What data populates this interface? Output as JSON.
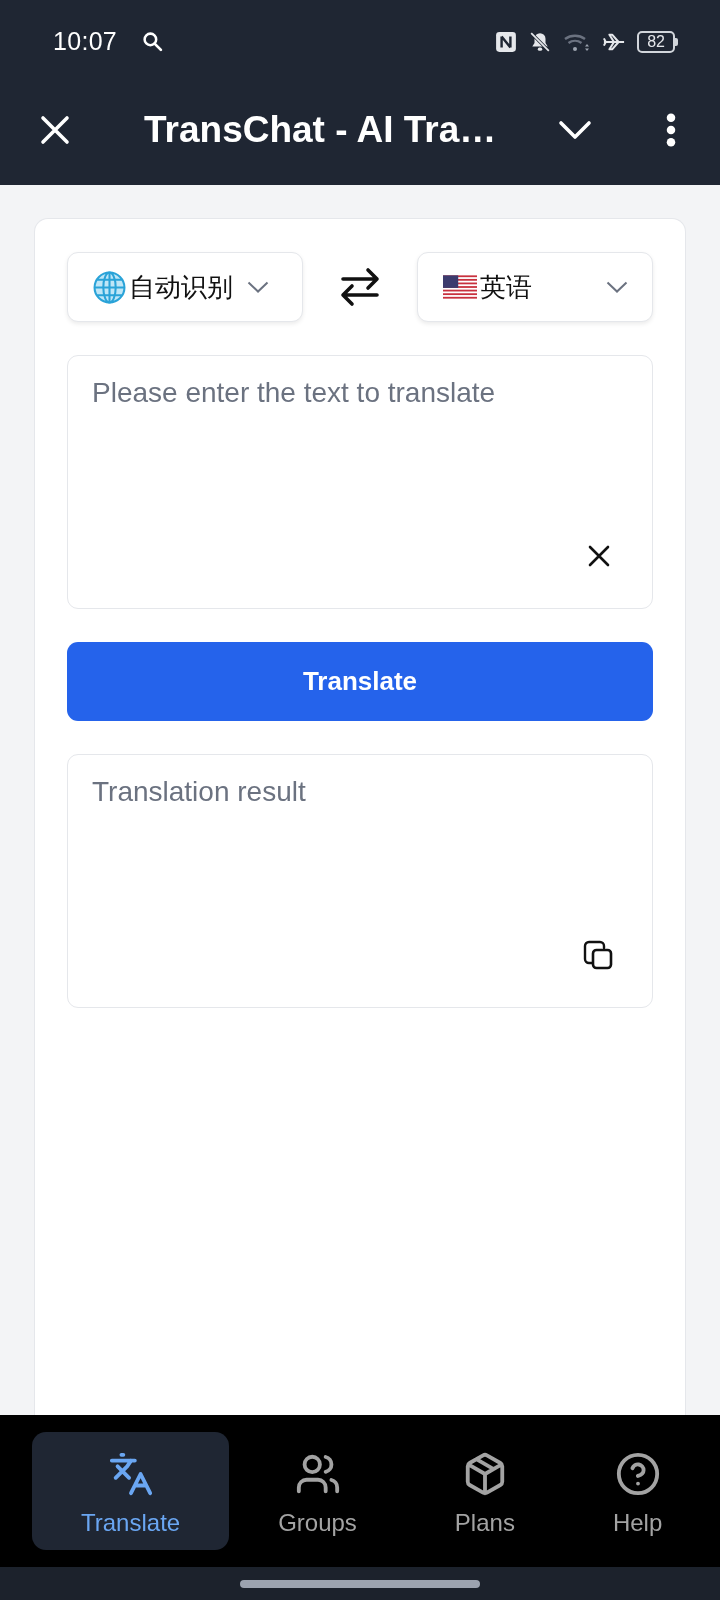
{
  "status_bar": {
    "time": "10:07",
    "battery": "82"
  },
  "header": {
    "title": "TransChat - AI Tra…"
  },
  "languages": {
    "source": {
      "label": "自动识别"
    },
    "target": {
      "label": "英语"
    }
  },
  "input": {
    "placeholder": "Please enter the text to translate"
  },
  "translate_button": {
    "label": "Translate"
  },
  "result": {
    "placeholder": "Translation result"
  },
  "nav": {
    "tabs": [
      {
        "label": "Translate",
        "selected": true
      },
      {
        "label": "Groups",
        "selected": false
      },
      {
        "label": "Plans",
        "selected": false
      },
      {
        "label": "Help",
        "selected": false
      }
    ]
  }
}
